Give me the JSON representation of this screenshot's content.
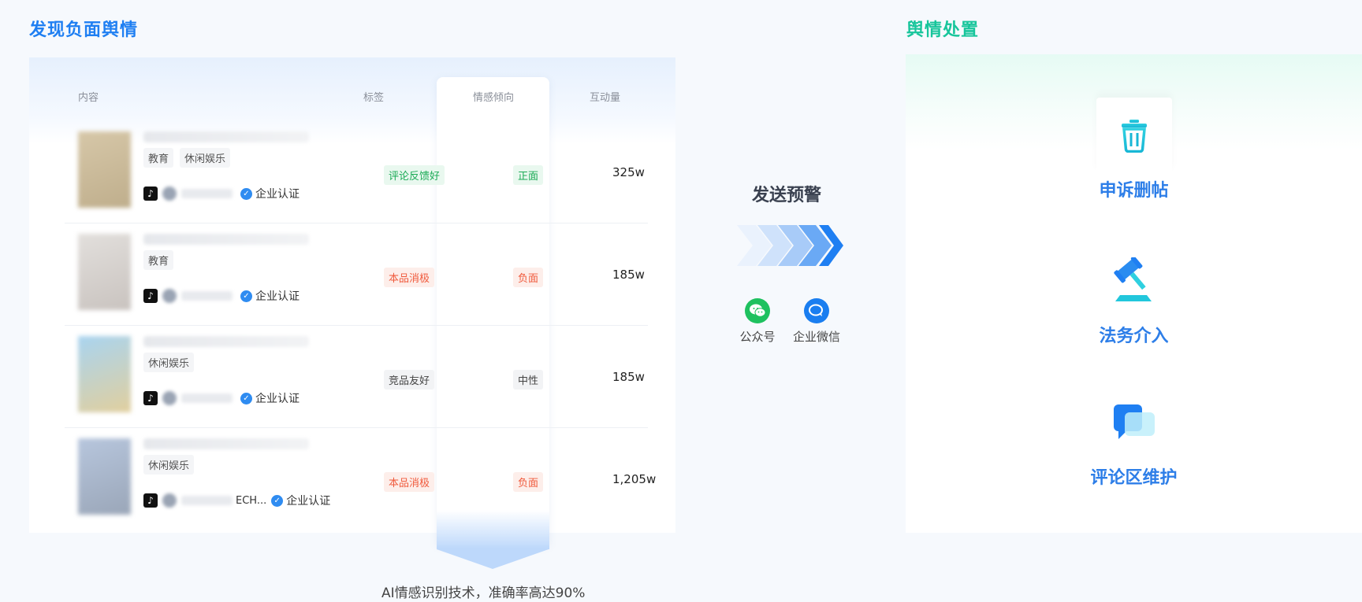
{
  "left": {
    "title": "发现负面舆情",
    "columns": {
      "content": "内容",
      "label": "标签",
      "sentiment": "情感倾向",
      "interaction": "互动量"
    },
    "rows": [
      {
        "tags": [
          "教育",
          "休闲娱乐"
        ],
        "author_suffix": "",
        "verified": "企业认证",
        "label": "评论反馈好",
        "label_tone": "green",
        "sentiment": "正面",
        "sentiment_tone": "green",
        "interaction": "325w",
        "thumb_colors": [
          "#d6c7a8",
          "#bfae8c"
        ]
      },
      {
        "tags": [
          "教育"
        ],
        "author_suffix": "",
        "verified": "企业认证",
        "label": "本品消极",
        "label_tone": "red",
        "sentiment": "负面",
        "sentiment_tone": "red",
        "interaction": "185w",
        "thumb_colors": [
          "#e2dfdc",
          "#c9c3bf"
        ]
      },
      {
        "tags": [
          "休闲娱乐"
        ],
        "author_suffix": "",
        "verified": "企业认证",
        "label": "竞品友好",
        "label_tone": "gray",
        "sentiment": "中性",
        "sentiment_tone": "gray",
        "interaction": "185w",
        "thumb_colors": [
          "#a9d4f0",
          "#e1cf9e"
        ]
      },
      {
        "tags": [
          "休闲娱乐"
        ],
        "author_suffix": "ECH...",
        "verified": "企业认证",
        "label": "本品消极",
        "label_tone": "red",
        "sentiment": "负面",
        "sentiment_tone": "red",
        "interaction": "1,205w",
        "thumb_colors": [
          "#b7c6dd",
          "#9aa6b8"
        ]
      }
    ],
    "caption": "AI情感识别技术，准确率高达90%"
  },
  "middle": {
    "title": "发送预警",
    "channels": [
      {
        "label": "公众号",
        "icon": "wechat-icon",
        "color": "#1ec15f"
      },
      {
        "label": "企业微信",
        "icon": "wecom-icon",
        "color": "#1a7ef0"
      }
    ]
  },
  "right": {
    "title": "舆情处置",
    "actions": [
      {
        "label": "申诉删帖",
        "icon": "trash-icon"
      },
      {
        "label": "法务介入",
        "icon": "gavel-icon"
      },
      {
        "label": "评论区维护",
        "icon": "chat-bubbles-icon"
      }
    ]
  },
  "colors": {
    "primary_blue": "#1f7ff2",
    "accent_green": "#17c59b",
    "positive": "#1aaa55",
    "negative": "#f05a3c"
  }
}
